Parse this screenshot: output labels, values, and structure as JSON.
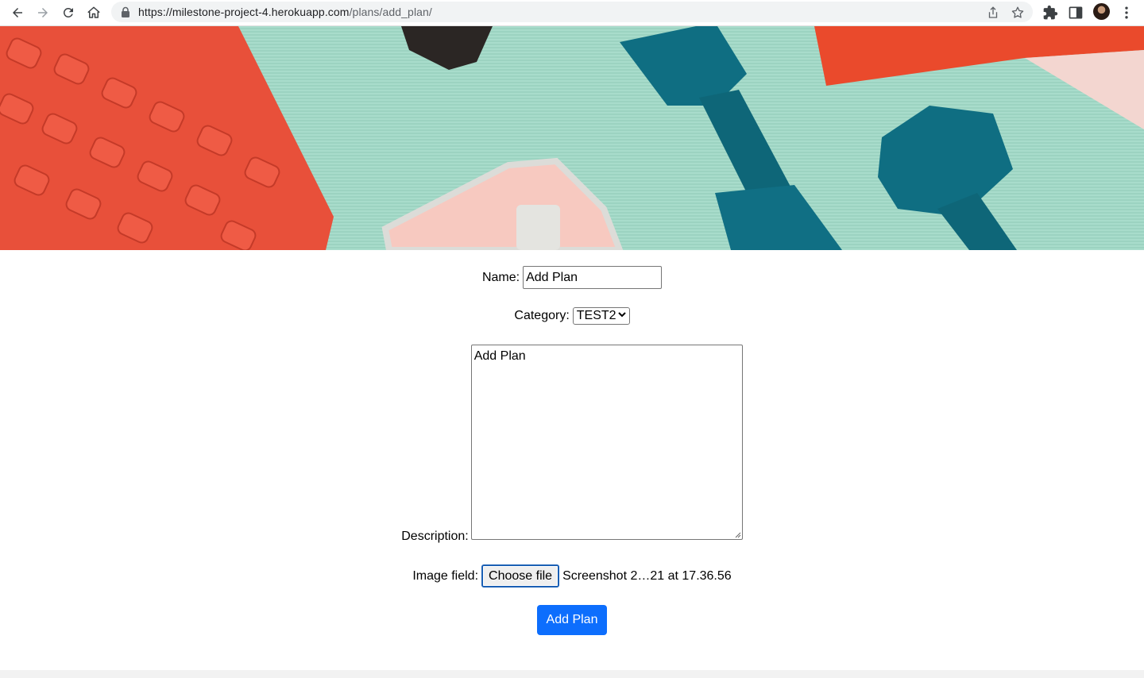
{
  "browser": {
    "url_host": "https://milestone-project-4.herokuapp.com",
    "url_path": "/plans/add_plan/"
  },
  "form": {
    "name_label": "Name:",
    "name_value": "Add Plan",
    "category_label": "Category:",
    "category_value": "TEST2",
    "description_label": "Description:",
    "description_value": "Add Plan",
    "image_label": "Image field:",
    "choose_file_label": "Choose file",
    "file_name": "Screenshot 2…21 at 17.36.56",
    "submit_label": "Add Plan"
  },
  "colors": {
    "primary_button": "#0d6efd",
    "hero_background": "#a5dac8"
  },
  "icons": [
    "back-icon",
    "forward-icon",
    "reload-icon",
    "home-icon",
    "lock-icon",
    "share-icon",
    "bookmark-star-icon",
    "extensions-icon",
    "side-panel-icon",
    "menu-icon"
  ]
}
